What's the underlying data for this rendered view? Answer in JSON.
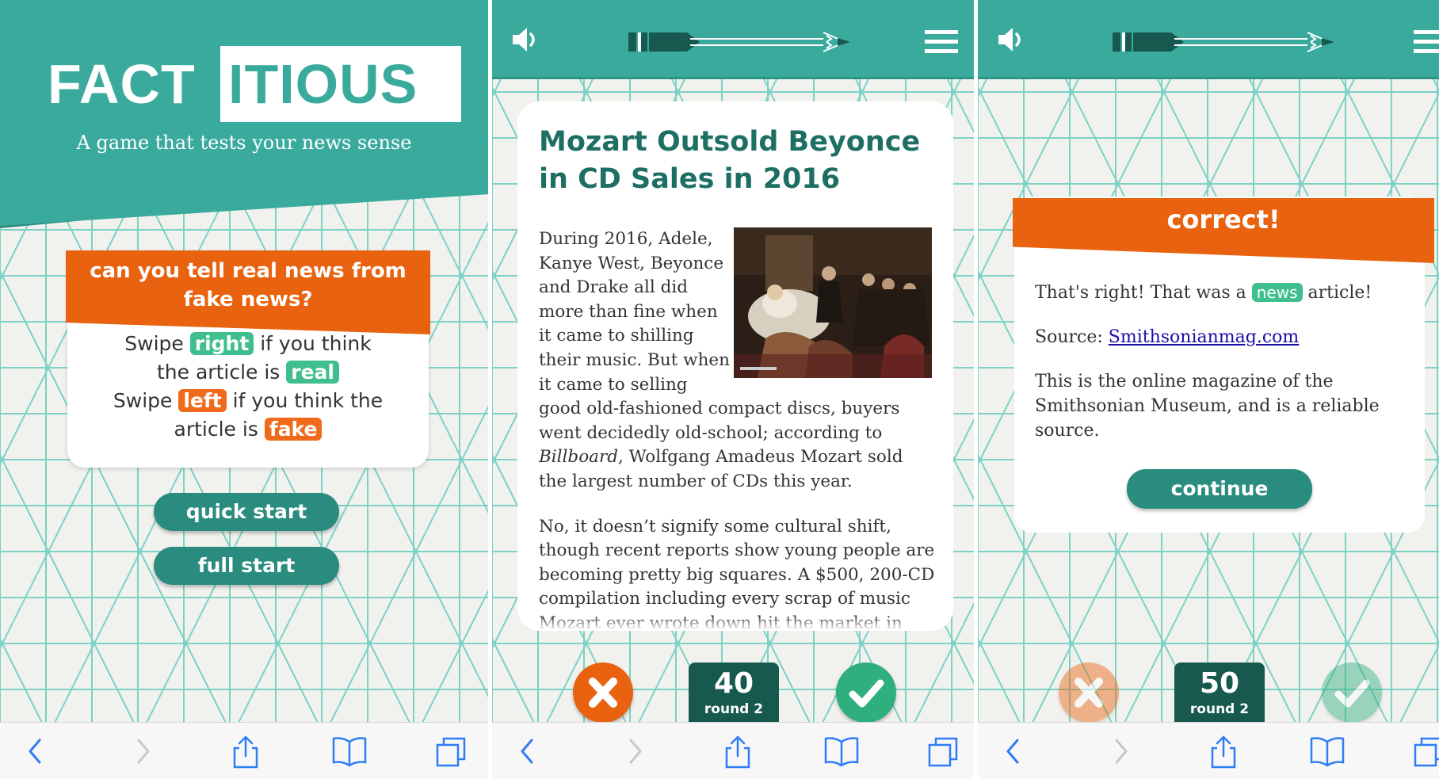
{
  "colors": {
    "teal": "#3aaa9d",
    "dark_teal": "#2a8c7f",
    "score_bg": "#17584f",
    "orange": "#e9620f",
    "green_highlight": "#3fbf8e",
    "wrong_red": "#e9620f",
    "right_green": "#2fae7e"
  },
  "icons": {
    "speaker": "speaker-icon",
    "pencil": "pencil-progress-icon",
    "menu": "hamburger-menu-icon",
    "back": "chevron-left-icon",
    "forward": "chevron-right-icon",
    "share": "share-icon",
    "bookmarks": "open-book-icon",
    "tabs": "tabs-icon",
    "wrong": "x-icon",
    "right": "checkmark-icon"
  },
  "home": {
    "logo_part1": "FACT",
    "logo_part2": "ITIOUS",
    "tagline": "A game that tests your news sense",
    "question_line1": "can you tell real news from",
    "question_line2": "fake news?",
    "swipe_word": "Swipe",
    "right_word": "right",
    "if_you_think": "if you think",
    "the_article_is": "the article is",
    "real_word": "real",
    "left_word": "left",
    "if_you_think_the": "if you think the",
    "article_is": "article is",
    "fake_word": "fake",
    "quick_start": "quick start",
    "full_start": "full start"
  },
  "article": {
    "title_line1": "Mozart Outsold Beyonce",
    "title_line2": "in CD Sales in 2016",
    "para1_start": "During 2016, Adele, Kanye West, Beyonce and Drake all did more than fine when it came to shilling their music. But when it came to selling good old-fashioned compact discs, buyers went decidedly old-school; according to ",
    "para1_italic": "Billboard",
    "para1_end": ", Wolfgang Amadeus Mozart sold the largest number of CDs this year.",
    "para2": "No, it doesn’t signify some cultural shift, though recent reports show young people are becoming pretty big squares. A $500, 200-CD compilation including every scrap of music Mozart ever wrote down hit the market in",
    "score": "40",
    "round": "round 2"
  },
  "result": {
    "title": "correct!",
    "line1_start": "That's right! That was a",
    "badge": "news",
    "line1_end": "article!",
    "source_label": "Source:",
    "source_link": "Smithsonianmag.com",
    "description": "This is the online magazine of the Smithsonian Museum, and is a reliable source.",
    "continue": "continue",
    "score": "50",
    "round": "round 2"
  }
}
